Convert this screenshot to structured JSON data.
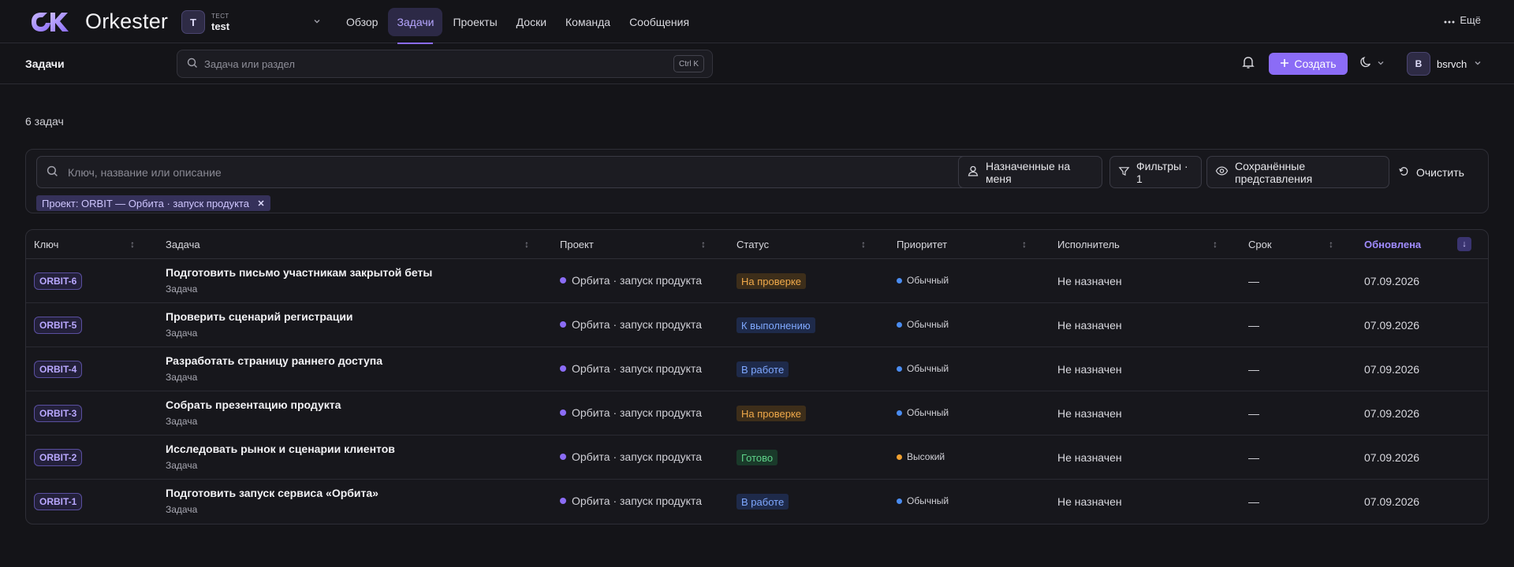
{
  "app": {
    "name": "Orkester"
  },
  "workspace": {
    "avatar": "T",
    "label": "ТЕСТ",
    "name": "test"
  },
  "nav": {
    "tabs": [
      {
        "label": "Обзор",
        "active": false
      },
      {
        "label": "Задачи",
        "active": true
      },
      {
        "label": "Проекты",
        "active": false
      },
      {
        "label": "Доски",
        "active": false
      },
      {
        "label": "Команда",
        "active": false
      },
      {
        "label": "Сообщения",
        "active": false
      }
    ],
    "more_label": "Ещё"
  },
  "subheader": {
    "title": "Задачи",
    "search_placeholder": "Задача или раздел",
    "shortcut": "Ctrl K",
    "create_label": "Создать",
    "user": {
      "avatar": "B",
      "name": "bsrvch"
    }
  },
  "task_count": "6 задач",
  "filters": {
    "search_placeholder": "Ключ, название или описание",
    "assigned_label": "Назначенные на меня",
    "filters_label": "Фильтры · 1",
    "saved_label": "Сохранённые представления",
    "clear_label": "Очистить",
    "active_chip": "Проект: ORBIT — Орбита · запуск продукта"
  },
  "table": {
    "columns": {
      "key": "Ключ",
      "task": "Задача",
      "project": "Проект",
      "status": "Статус",
      "priority": "Приоритет",
      "assignee": "Исполнитель",
      "due": "Срок",
      "updated": "Обновлена"
    },
    "rows": [
      {
        "key": "ORBIT-6",
        "title": "Подготовить письмо участникам закрытой беты",
        "type": "Задача",
        "project": "Орбита · запуск продукта",
        "status": "На проверке",
        "status_kind": "review",
        "priority": "Обычный",
        "priority_kind": "normal",
        "assignee": "Не назначен",
        "due": "—",
        "updated": "07.09.2026"
      },
      {
        "key": "ORBIT-5",
        "title": "Проверить сценарий регистрации",
        "type": "Задача",
        "project": "Орбита · запуск продукта",
        "status": "К выполнению",
        "status_kind": "todo",
        "priority": "Обычный",
        "priority_kind": "normal",
        "assignee": "Не назначен",
        "due": "—",
        "updated": "07.09.2026"
      },
      {
        "key": "ORBIT-4",
        "title": "Разработать страницу раннего доступа",
        "type": "Задача",
        "project": "Орбита · запуск продукта",
        "status": "В работе",
        "status_kind": "progress",
        "priority": "Обычный",
        "priority_kind": "normal",
        "assignee": "Не назначен",
        "due": "—",
        "updated": "07.09.2026"
      },
      {
        "key": "ORBIT-3",
        "title": "Собрать презентацию продукта",
        "type": "Задача",
        "project": "Орбита · запуск продукта",
        "status": "На проверке",
        "status_kind": "review",
        "priority": "Обычный",
        "priority_kind": "normal",
        "assignee": "Не назначен",
        "due": "—",
        "updated": "07.09.2026"
      },
      {
        "key": "ORBIT-2",
        "title": "Исследовать рынок и сценарии клиентов",
        "type": "Задача",
        "project": "Орбита · запуск продукта",
        "status": "Готово",
        "status_kind": "done",
        "priority": "Высокий",
        "priority_kind": "high",
        "assignee": "Не назначен",
        "due": "—",
        "updated": "07.09.2026"
      },
      {
        "key": "ORBIT-1",
        "title": "Подготовить запуск сервиса «Орбита»",
        "type": "Задача",
        "project": "Орбита · запуск продукта",
        "status": "В работе",
        "status_kind": "progress",
        "priority": "Обычный",
        "priority_kind": "normal",
        "assignee": "Не назначен",
        "due": "—",
        "updated": "07.09.2026"
      }
    ]
  },
  "colors": {
    "accent": "#8b6cf6",
    "status_review_bg": "#3d2e1a",
    "status_review_fg": "#f0a94a",
    "status_todo_bg": "#1e2a4a",
    "status_todo_fg": "#7fa8ff",
    "status_progress_bg": "#1e2a4a",
    "status_progress_fg": "#7fa8ff",
    "status_done_bg": "#1a3a2a",
    "status_done_fg": "#5fd38a",
    "priority_normal": "#4a8cf0",
    "priority_high": "#f0a030"
  }
}
